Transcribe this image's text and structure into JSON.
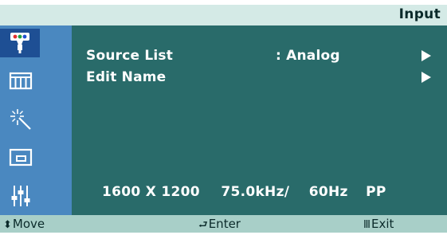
{
  "header": {
    "title": "Input"
  },
  "sidebar": {
    "items": [
      {
        "icon": "input-source-icon",
        "active": true
      },
      {
        "icon": "picture-icon",
        "active": false
      },
      {
        "icon": "magic-wand-icon",
        "active": false
      },
      {
        "icon": "pip-window-icon",
        "active": false
      },
      {
        "icon": "setup-sliders-icon",
        "active": false
      }
    ]
  },
  "menu": {
    "items": [
      {
        "label": "Source List",
        "value": ": Analog"
      },
      {
        "label": "Edit Name",
        "value": ""
      }
    ]
  },
  "status": {
    "resolution": "1600 X 1200",
    "h_freq": "75.0kHz/",
    "v_freq": "60Hz",
    "polarity": "PP"
  },
  "footer": {
    "move_label": "Move",
    "enter_label": "Enter",
    "exit_label": "Exit"
  },
  "colors": {
    "title_bar": "#d4eae6",
    "sidebar": "#4a88c0",
    "sidebar_active": "#1e4f94",
    "main_panel": "#296b6a",
    "footer": "#a8cfc8"
  }
}
